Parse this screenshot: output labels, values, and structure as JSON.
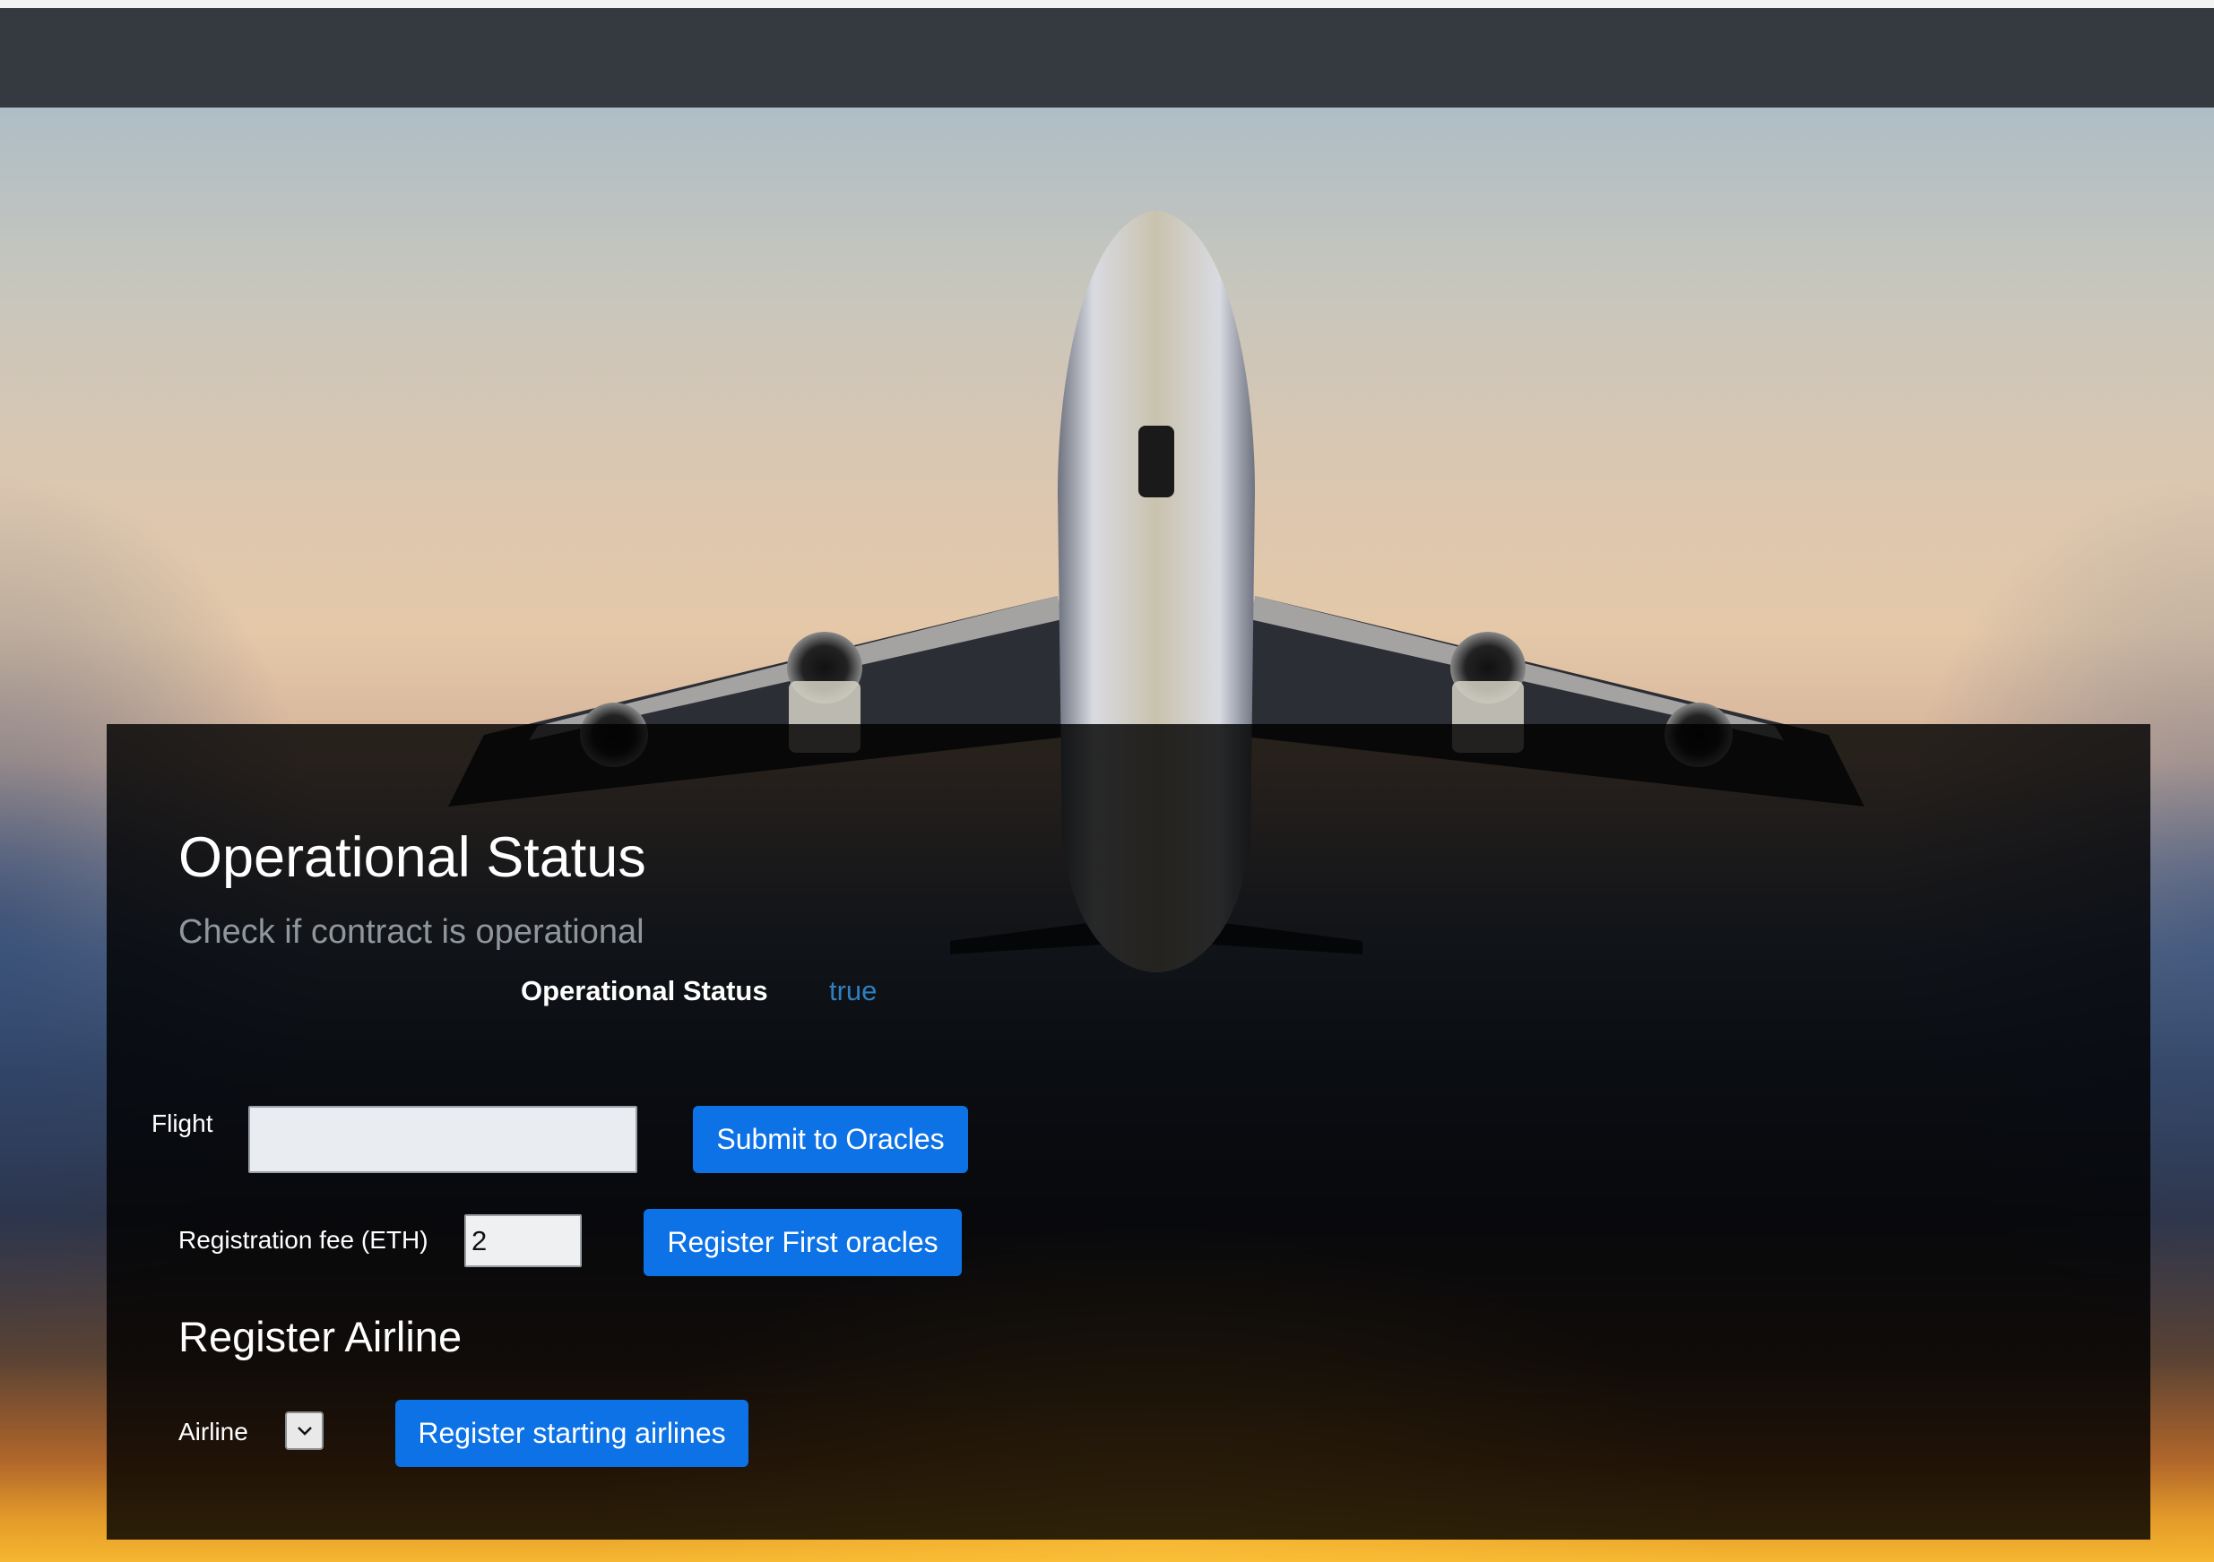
{
  "navbar": {
    "brand": ""
  },
  "hero": {
    "image": "airplane-takeoff-sunset"
  },
  "status_section": {
    "title": "Operational Status",
    "subtitle": "Check if contract is operational",
    "status_label": "Operational Status",
    "status_value": "true"
  },
  "flight_form": {
    "label": "Flight",
    "value": "",
    "submit_label": "Submit to Oracles"
  },
  "oracle_form": {
    "fee_label": "Registration fee (ETH)",
    "fee_value": "2",
    "register_label": "Register First oracles"
  },
  "airline_section": {
    "title": "Register Airline",
    "label": "Airline",
    "selected": "",
    "register_label": "Register starting airlines"
  },
  "colors": {
    "navbar": "#343a40",
    "button": "#0d72e6",
    "status_true": "#2f7fc0",
    "panel": "rgba(0,0,0,0.82)"
  }
}
